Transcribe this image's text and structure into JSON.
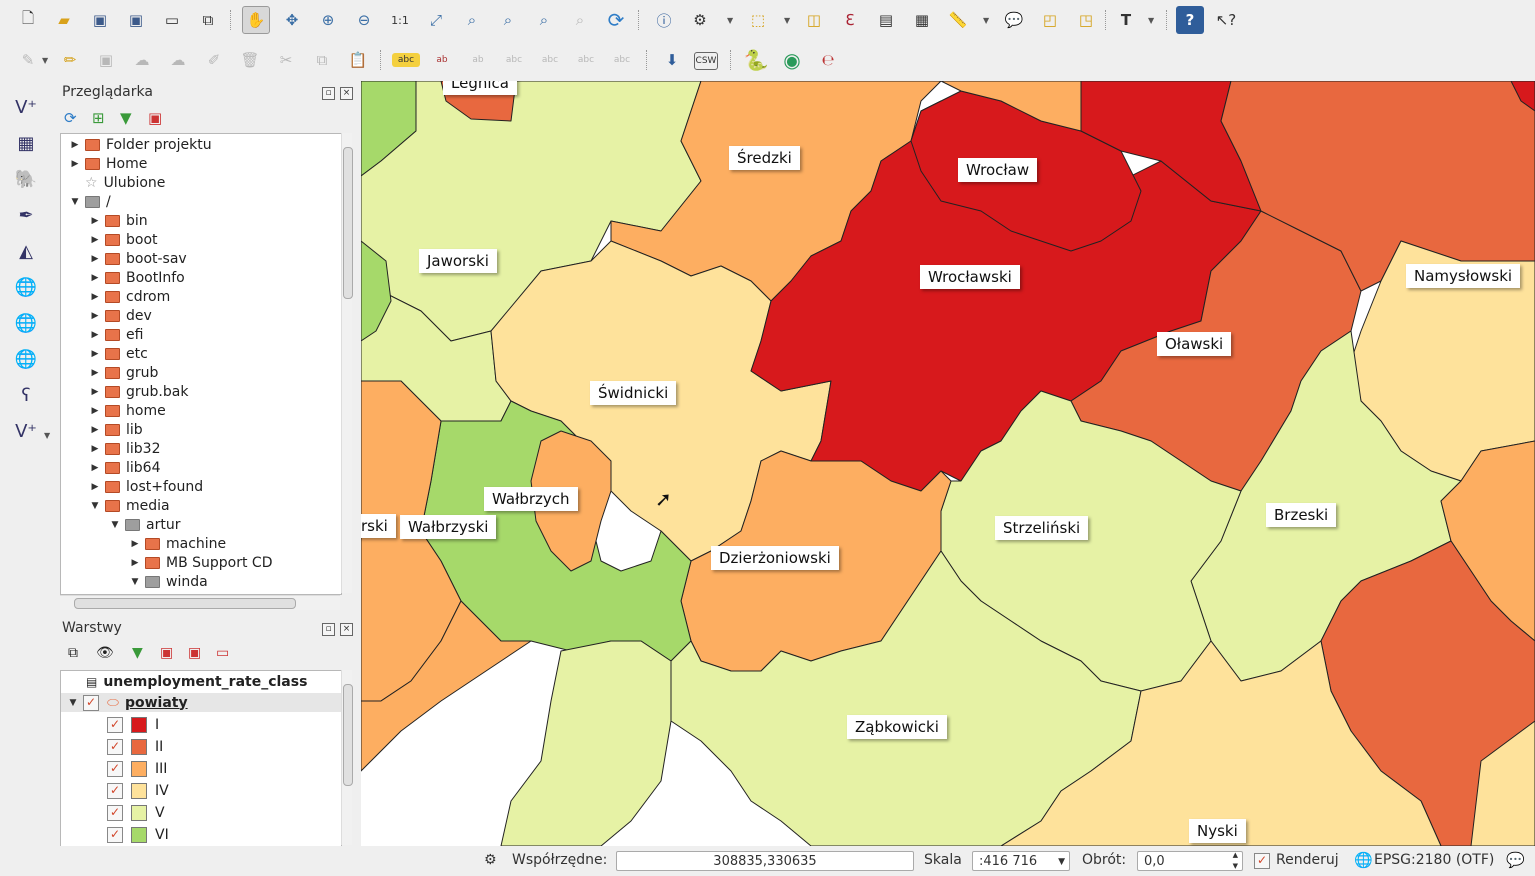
{
  "toolbar1": {
    "icons": [
      "new-project-icon",
      "open-project-icon",
      "save-project-icon",
      "save-as-icon",
      "new-print-composer-icon",
      "composer-manager-icon",
      "pan-icon",
      "pan-to-selection-icon",
      "zoom-in-icon",
      "zoom-out-icon",
      "zoom-native-icon",
      "zoom-full-icon",
      "zoom-to-selection-icon",
      "zoom-to-layer-icon",
      "zoom-last-icon",
      "zoom-next-icon",
      "refresh-icon",
      "identify-icon",
      "action-icon",
      "select-features-icon",
      "deselect-icon",
      "field-calculator-icon",
      "attribute-table-icon",
      "statistics-icon",
      "measure-icon",
      "map-tips-icon",
      "new-bookmark-icon",
      "show-bookmarks-icon",
      "text-annotation-icon",
      "help-contents-icon",
      "whats-this-icon"
    ]
  },
  "toolbar2": {
    "icons": [
      "digitize-icon",
      "toggle-editing-icon",
      "save-edits-icon",
      "add-feature-icon",
      "move-feature-icon",
      "node-tool-icon",
      "delete-selected-icon",
      "cut-features-icon",
      "copy-features-icon",
      "paste-features-icon",
      "layer-labeling-icon",
      "label-pin-icon",
      "label-show-hide-icon",
      "label-highlight-icon",
      "label-move-icon",
      "label-rotate-icon",
      "label-change-icon",
      "geosearch-icon",
      "csw-label",
      "python-icon",
      "globe-icon",
      "symbol-icon"
    ],
    "csw_label": "CSW"
  },
  "browser": {
    "title": "Przeglądarka",
    "items": [
      {
        "label": "Folder projektu",
        "depth": 0,
        "expander": "▶",
        "icon": "folder"
      },
      {
        "label": "Home",
        "depth": 0,
        "expander": "▶",
        "icon": "folder"
      },
      {
        "label": "Ulubione",
        "depth": 0,
        "expander": "",
        "icon": "star"
      },
      {
        "label": "/",
        "depth": 0,
        "expander": "▼",
        "icon": "gray"
      },
      {
        "label": "bin",
        "depth": 1,
        "expander": "▶",
        "icon": "folder"
      },
      {
        "label": "boot",
        "depth": 1,
        "expander": "▶",
        "icon": "folder"
      },
      {
        "label": "boot-sav",
        "depth": 1,
        "expander": "▶",
        "icon": "folder"
      },
      {
        "label": "BootInfo",
        "depth": 1,
        "expander": "▶",
        "icon": "folder"
      },
      {
        "label": "cdrom",
        "depth": 1,
        "expander": "▶",
        "icon": "folder"
      },
      {
        "label": "dev",
        "depth": 1,
        "expander": "▶",
        "icon": "folder"
      },
      {
        "label": "efi",
        "depth": 1,
        "expander": "▶",
        "icon": "folder"
      },
      {
        "label": "etc",
        "depth": 1,
        "expander": "▶",
        "icon": "folder"
      },
      {
        "label": "grub",
        "depth": 1,
        "expander": "▶",
        "icon": "folder"
      },
      {
        "label": "grub.bak",
        "depth": 1,
        "expander": "▶",
        "icon": "folder"
      },
      {
        "label": "home",
        "depth": 1,
        "expander": "▶",
        "icon": "folder"
      },
      {
        "label": "lib",
        "depth": 1,
        "expander": "▶",
        "icon": "folder"
      },
      {
        "label": "lib32",
        "depth": 1,
        "expander": "▶",
        "icon": "folder"
      },
      {
        "label": "lib64",
        "depth": 1,
        "expander": "▶",
        "icon": "folder"
      },
      {
        "label": "lost+found",
        "depth": 1,
        "expander": "▶",
        "icon": "folder"
      },
      {
        "label": "media",
        "depth": 1,
        "expander": "▼",
        "icon": "folder"
      },
      {
        "label": "artur",
        "depth": 2,
        "expander": "▼",
        "icon": "gray"
      },
      {
        "label": "machine",
        "depth": 3,
        "expander": "▶",
        "icon": "folder"
      },
      {
        "label": "MB Support CD",
        "depth": 3,
        "expander": "▶",
        "icon": "folder"
      },
      {
        "label": "winda",
        "depth": 3,
        "expander": "▼",
        "icon": "gray"
      }
    ]
  },
  "layers": {
    "title": "Warstwy",
    "table_layer": "unemployment_rate_class",
    "group_layer": "powiaty",
    "classes": [
      {
        "label": "I",
        "color": "#d7191c"
      },
      {
        "label": "II",
        "color": "#e8683f"
      },
      {
        "label": "III",
        "color": "#fdae61"
      },
      {
        "label": "IV",
        "color": "#fee29b"
      },
      {
        "label": "V",
        "color": "#e6f2a5"
      },
      {
        "label": "VI",
        "color": "#a6d96a"
      }
    ]
  },
  "map": {
    "labels": [
      {
        "id": "legnica",
        "text": "Legnica"
      },
      {
        "id": "sredzki",
        "text": "Średzki"
      },
      {
        "id": "wroclaw",
        "text": "Wrocław"
      },
      {
        "id": "jaworski",
        "text": "Jaworski"
      },
      {
        "id": "wroclawski",
        "text": "Wrocławski"
      },
      {
        "id": "namyslowski",
        "text": "Namysłowski"
      },
      {
        "id": "olawski",
        "text": "Oławski"
      },
      {
        "id": "swidnicki",
        "text": "Świdnicki"
      },
      {
        "id": "walbrzych",
        "text": "Wałbrzych"
      },
      {
        "id": "walbrzyski",
        "text": "Wałbrzyski"
      },
      {
        "id": "rski",
        "text": "rski"
      },
      {
        "id": "brzeski",
        "text": "Brzeski"
      },
      {
        "id": "strzelinski",
        "text": "Strzeliński"
      },
      {
        "id": "dzierzoniowski",
        "text": "Dzierżoniowski"
      },
      {
        "id": "zabkowicki",
        "text": "Ząbkowicki"
      },
      {
        "id": "nyski",
        "text": "Nyski"
      }
    ]
  },
  "status": {
    "coords_label": "Współrzędne:",
    "coords_value": "308835,330635",
    "scale_label": "Skala",
    "scale_value": ":416 716",
    "rotation_label": "Obrót:",
    "rotation_value": "0,0",
    "render_label": "Renderuj",
    "crs_label": "EPSG:2180 (OTF)"
  }
}
